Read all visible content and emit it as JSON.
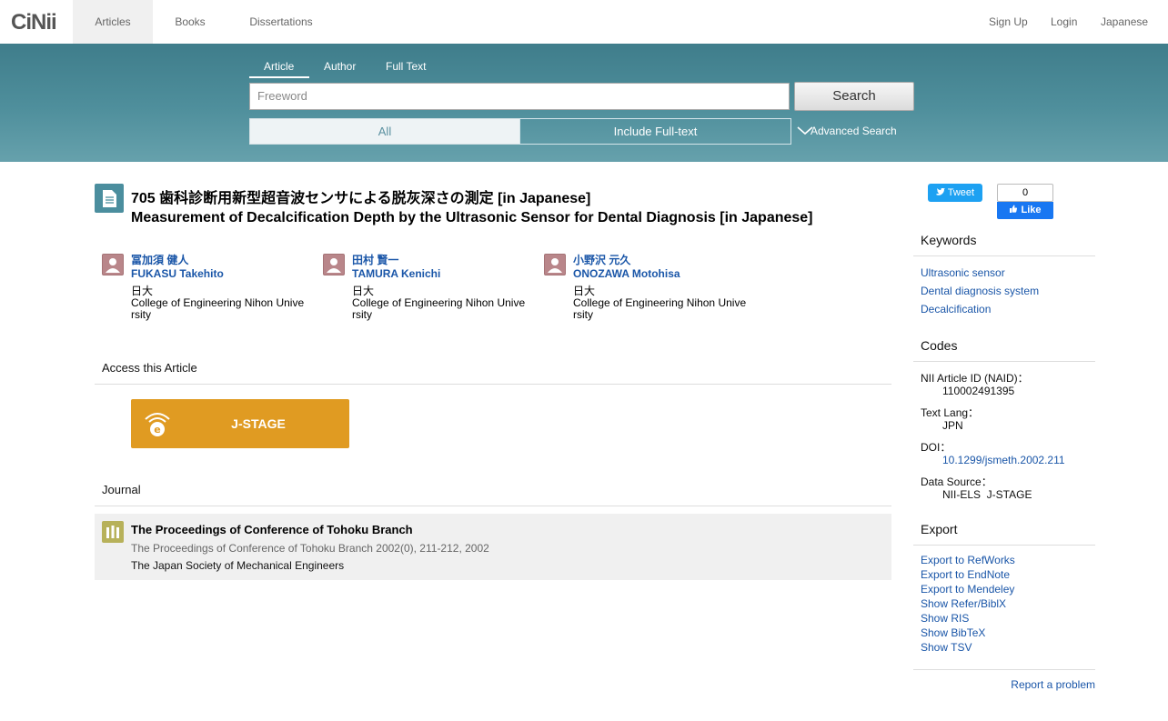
{
  "brand": {
    "logo": "CiNii"
  },
  "topnav": {
    "tabs": [
      "Articles",
      "Books",
      "Dissertations"
    ],
    "right": [
      "Sign Up",
      "Login",
      "Japanese"
    ]
  },
  "search": {
    "tabs": [
      "Article",
      "Author",
      "Full Text"
    ],
    "placeholder": "Freeword",
    "button": "Search",
    "scope_all": "All",
    "scope_full": "Include Full-text",
    "advanced": "Advanced Search"
  },
  "article": {
    "title_ja": "705 歯科診断用新型超音波センサによる脱灰深さの測定 [in Japanese]",
    "title_en": "Measurement of Decalcification Depth by the Ultrasonic Sensor for Dental Diagnosis [in Japanese]",
    "authors": [
      {
        "name_ja": "冨加須 健人",
        "name_en": "FUKASU Takehito",
        "aff_ja": "日大",
        "aff_en": "College of Engineering Nihon University"
      },
      {
        "name_ja": "田村 賢一",
        "name_en": "TAMURA Kenichi",
        "aff_ja": "日大",
        "aff_en": "College of Engineering Nihon University"
      },
      {
        "name_ja": "小野沢 元久",
        "name_en": "ONOZAWA Motohisa",
        "aff_ja": "日大",
        "aff_en": "College of Engineering Nihon University"
      }
    ]
  },
  "access": {
    "heading": "Access this Article",
    "jstage": "J-STAGE"
  },
  "journal": {
    "heading": "Journal",
    "title": "The Proceedings of Conference of Tohoku Branch",
    "citation": "The Proceedings of Conference of Tohoku Branch 2002(0), 211-212, 2002",
    "publisher": "The Japan Society of Mechanical Engineers"
  },
  "social": {
    "tweet": "Tweet",
    "fb_count": "0",
    "fb_like": "Like"
  },
  "keywords": {
    "heading": "Keywords",
    "items": [
      "Ultrasonic sensor",
      "Dental diagnosis system",
      "Decalcification"
    ]
  },
  "codes": {
    "heading": "Codes",
    "naid_label": "NII Article ID (NAID)：",
    "naid": "110002491395",
    "lang_label": "Text Lang：",
    "lang": "JPN",
    "doi_label": "DOI：",
    "doi": "10.1299/jsmeth.2002.211",
    "source_label": "Data Source：",
    "source": "NII-ELS  J-STAGE"
  },
  "export": {
    "heading": "Export",
    "items": [
      "Export to RefWorks",
      "Export to EndNote",
      "Export to Mendeley",
      "Show Refer/BiblX",
      "Show RIS",
      "Show BibTeX",
      "Show TSV"
    ]
  },
  "report": "Report a problem",
  "colors": {
    "band": "#4f8f9c",
    "link": "#1a56a8",
    "jstage": "#e09b22"
  }
}
